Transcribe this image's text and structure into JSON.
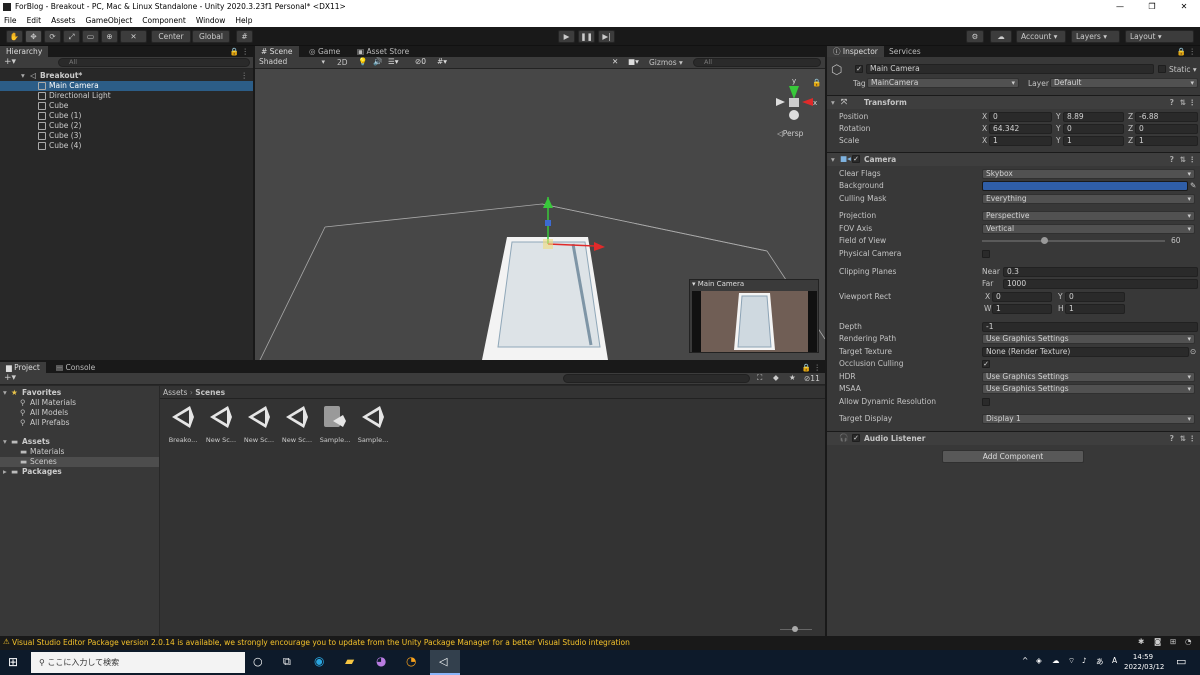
{
  "window": {
    "title": "ForBlog - Breakout - PC, Mac & Linux Standalone - Unity 2020.3.23f1 Personal* <DX11>",
    "min": "—",
    "max": "❐",
    "close": "✕"
  },
  "menu": [
    "File",
    "Edit",
    "Assets",
    "GameObject",
    "Component",
    "Window",
    "Help"
  ],
  "toolbar": {
    "center": "Center",
    "global": "Global",
    "account": "Account",
    "layers": "Layers",
    "layout": "Layout"
  },
  "hierarchy": {
    "tab": "Hierarchy",
    "search": "All",
    "scene": "Breakout*",
    "items": [
      "Main Camera",
      "Directional Light",
      "Cube",
      "Cube (1)",
      "Cube (2)",
      "Cube (3)",
      "Cube (4)"
    ]
  },
  "scene": {
    "tabs": [
      "Scene",
      "Game",
      "Asset Store"
    ],
    "shading": "Shaded",
    "mode2d": "2D",
    "gizmos": "Gizmos",
    "search": "All",
    "persp": "Persp",
    "preview_title": "Main Camera",
    "axis_x": "x",
    "axis_y": "y"
  },
  "inspector": {
    "tabs": [
      "Inspector",
      "Services"
    ],
    "object_name": "Main Camera",
    "static": "Static",
    "tag_label": "Tag",
    "tag": "MainCamera",
    "layer_label": "Layer",
    "layer": "Default",
    "transform": {
      "title": "Transform",
      "position_label": "Position",
      "rotation_label": "Rotation",
      "scale_label": "Scale",
      "position": [
        "0",
        "8.89",
        "-6.88"
      ],
      "rotation": [
        "64.342",
        "0",
        "0"
      ],
      "scale": [
        "1",
        "1",
        "1"
      ]
    },
    "camera": {
      "title": "Camera",
      "clear_flags_label": "Clear Flags",
      "clear_flags": "Skybox",
      "background_label": "Background",
      "background_color": "#2f5ea8",
      "culling_label": "Culling Mask",
      "culling": "Everything",
      "projection_label": "Projection",
      "projection": "Perspective",
      "fov_axis_label": "FOV Axis",
      "fov_axis": "Vertical",
      "fov_label": "Field of View",
      "fov": "60",
      "fov_fraction": 0.34,
      "physical_label": "Physical Camera",
      "clipping_label": "Clipping Planes",
      "near_label": "Near",
      "near": "0.3",
      "far_label": "Far",
      "far": "1000",
      "viewport_label": "Viewport Rect",
      "vx": "0",
      "vy": "0",
      "vw": "1",
      "vh": "1",
      "depth_label": "Depth",
      "depth": "-1",
      "render_path_label": "Rendering Path",
      "render_path": "Use Graphics Settings",
      "target_tex_label": "Target Texture",
      "target_tex": "None (Render Texture)",
      "occlusion_label": "Occlusion Culling",
      "hdr_label": "HDR",
      "hdr": "Use Graphics Settings",
      "msaa_label": "MSAA",
      "msaa": "Use Graphics Settings",
      "dyn_res_label": "Allow Dynamic Resolution",
      "target_display_label": "Target Display",
      "target_display": "Display 1"
    },
    "audio_listener": "Audio Listener",
    "add_component": "Add Component"
  },
  "project": {
    "tabs": [
      "Project",
      "Console"
    ],
    "favorites": "Favorites",
    "fav_items": [
      "All Materials",
      "All Models",
      "All Prefabs"
    ],
    "assets": "Assets",
    "asset_items": [
      "Materials",
      "Scenes"
    ],
    "packages": "Packages",
    "breadcrumb": [
      "Assets",
      "Scenes"
    ],
    "files": [
      "Breako...",
      "New Sc...",
      "New Sc...",
      "New Sc...",
      "Sample...",
      "Sample..."
    ],
    "hidden_count": "11"
  },
  "status": {
    "message": "Visual Studio Editor Package version 2.0.14 is available, we strongly encourage you to update from the Unity Package Manager for a better Visual Studio integration"
  },
  "taskbar": {
    "search": "ここに入力して検索",
    "time": "14:59",
    "date": "2022/03/12",
    "ime": "A"
  }
}
